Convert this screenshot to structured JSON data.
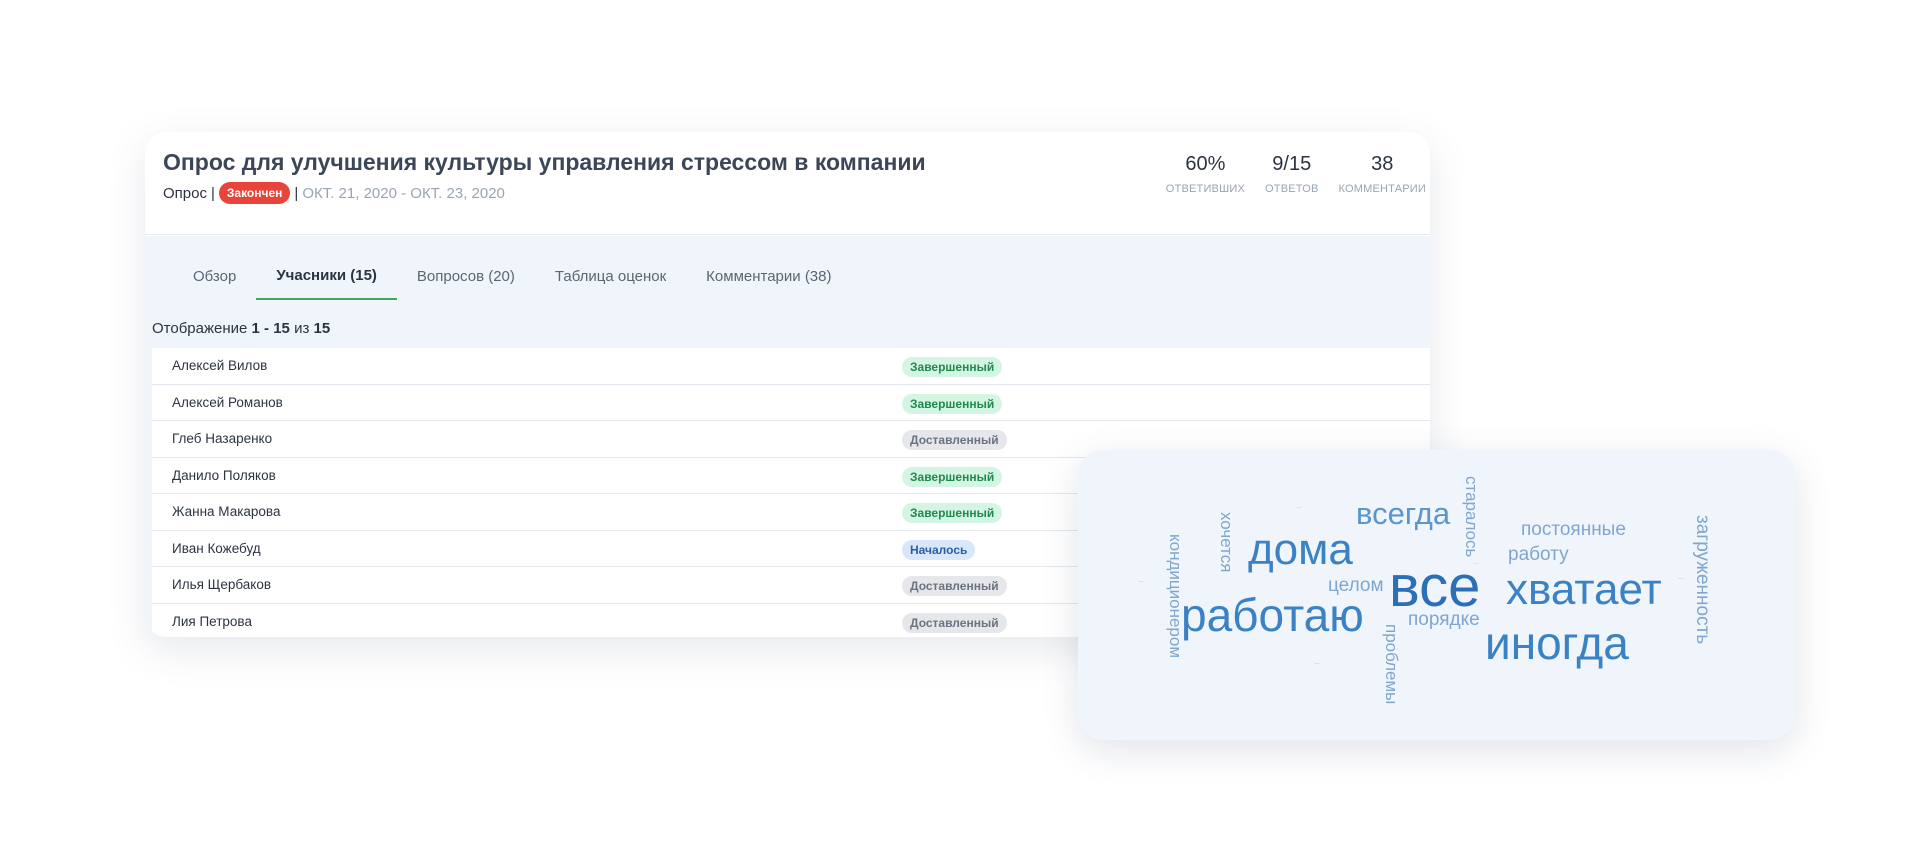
{
  "survey": {
    "title": "Опрос для улучшения культуры управления стрессом в компании",
    "type": "Опрос",
    "status": "Закончен",
    "dates": "ОКТ. 21, 2020 - ОКТ. 23, 2020"
  },
  "stats": [
    {
      "value": "60%",
      "label": "ОТВЕТИВШИХ"
    },
    {
      "value": "9/15",
      "label": "ОТВЕТОВ"
    },
    {
      "value": "38",
      "label": "КОММЕНТАРИИ"
    }
  ],
  "tabs": [
    {
      "label": "Обзор",
      "active": false
    },
    {
      "label": "Учасники (15)",
      "active": true
    },
    {
      "label": "Вопросов (20)",
      "active": false
    },
    {
      "label": "Таблица оценок",
      "active": false
    },
    {
      "label": "Комментарии (38)",
      "active": false
    }
  ],
  "showing": {
    "prefix": "Отображение ",
    "range": "1 - 15",
    "of": " из ",
    "total": "15"
  },
  "participants": [
    {
      "name": "Алексей Вилов",
      "status": "Завершенный",
      "kind": "done"
    },
    {
      "name": "Алексей Романов",
      "status": "Завершенный",
      "kind": "done"
    },
    {
      "name": "Глеб Назаренко",
      "status": "Доставленный",
      "kind": "sent"
    },
    {
      "name": "Данило Поляков",
      "status": "Завершенный",
      "kind": "done"
    },
    {
      "name": "Жанна Макарова",
      "status": "Завершенный",
      "kind": "done"
    },
    {
      "name": "Иван Кожебуд",
      "status": "Началось",
      "kind": "start"
    },
    {
      "name": "Илья Щербаков",
      "status": "Доставленный",
      "kind": "sent"
    },
    {
      "name": "Лия Петрова",
      "status": "Доставленный",
      "kind": "sent"
    }
  ],
  "word_cloud": {
    "words": [
      "все",
      "работаю",
      "дома",
      "хватает",
      "иногда",
      "всегда",
      "загруженность",
      "кондиционером",
      "хочется",
      "постоянные",
      "работу",
      "старалось",
      "целом",
      "порядке",
      "проблемы"
    ],
    "colors": {
      "dark": "#2c6fb7",
      "mid": "#3a82c4",
      "light": "#7fa6cf"
    }
  }
}
